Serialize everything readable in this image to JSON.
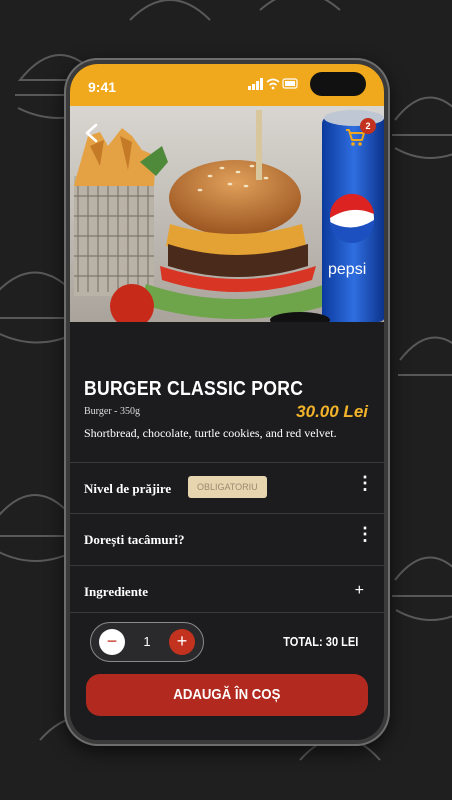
{
  "status_bar": {
    "time": "9:41"
  },
  "header": {
    "back_icon": "chevron-left-icon",
    "cart_icon": "cart-icon",
    "cart_count": "2"
  },
  "product": {
    "name": "BURGER CLASSIC PORC",
    "category": "Burger",
    "weight": "350g",
    "price": "30.00 Lei",
    "description": "Shortbread, chocolate, turtle cookies, and red velvet."
  },
  "options": [
    {
      "label": "Nivel de prăjire",
      "badge": "OBLIGATORIU"
    },
    {
      "label": "Dorești tacâmuri?"
    },
    {
      "label": "Ingrediente"
    }
  ],
  "quantity": {
    "minus": "−",
    "value": "1",
    "plus": "+"
  },
  "total": "TOTAL: 30 LEI",
  "add_button": "ADAUGĂ ÎN COȘ",
  "colors": {
    "accent": "#f0a81c",
    "brand_red": "#b22a1f",
    "price": "#f2b32a",
    "background": "#1c1c1e"
  }
}
